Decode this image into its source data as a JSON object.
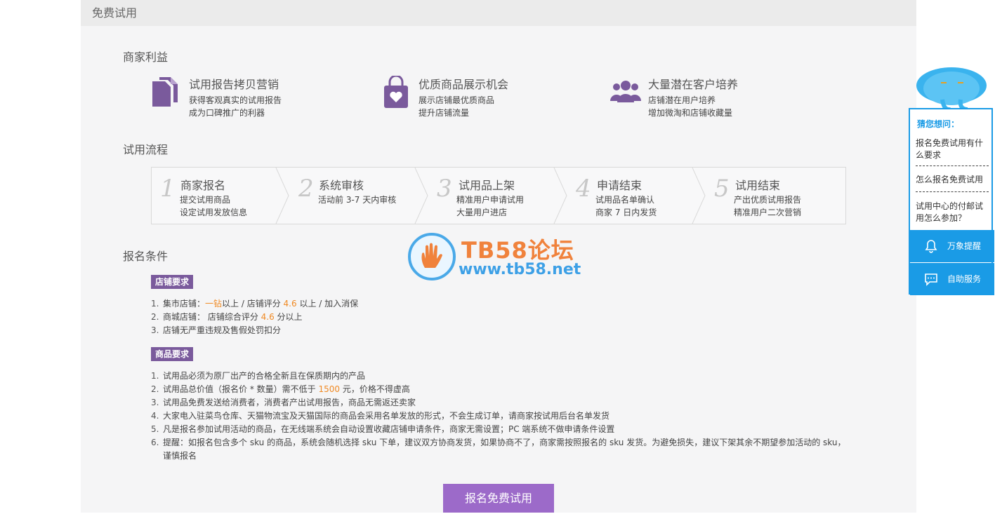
{
  "header": {
    "title": "免费试用"
  },
  "benefits_section": {
    "title": "商家利益",
    "items": [
      {
        "icon": "document-copy-icon",
        "title": "试用报告拷贝营销",
        "lines": [
          "获得客观真实的试用报告",
          "成为口碑推广的利器"
        ]
      },
      {
        "icon": "shopping-bag-heart-icon",
        "title": "优质商品展示机会",
        "lines": [
          "展示店铺最优质商品",
          "提升店铺流量"
        ]
      },
      {
        "icon": "users-group-icon",
        "title": "大量潜在客户培养",
        "lines": [
          "店铺潜在用户培养",
          "增加微淘和店铺收藏量"
        ]
      }
    ]
  },
  "process_section": {
    "title": "试用流程",
    "steps": [
      {
        "num": "1",
        "title": "商家报名",
        "lines": [
          "提交试用商品",
          "设定试用发放信息"
        ]
      },
      {
        "num": "2",
        "title": "系统审核",
        "lines": [
          "活动前 3-7 天内审核"
        ]
      },
      {
        "num": "3",
        "title": "试用品上架",
        "lines": [
          "精准用户申请试用",
          "大量用户进店"
        ]
      },
      {
        "num": "4",
        "title": "申请结束",
        "lines": [
          "试用品名单确认",
          "商家 7 日内发货"
        ]
      },
      {
        "num": "5",
        "title": "试用结束",
        "lines": [
          "产出优质试用报告",
          "精准用户二次营销"
        ]
      }
    ]
  },
  "conditions_section": {
    "title": "报名条件",
    "shop_tag": "店铺要求",
    "shop_items": [
      {
        "n": "1.",
        "p1": "集市店铺：",
        "h1": "一钻",
        "p2": "以上 / 店铺评分 ",
        "h2": "4.6",
        "p3": " 以上 / 加入消保"
      },
      {
        "n": "2.",
        "p1": "商城店铺： 店铺综合评分 ",
        "h1": "4.6",
        "p2": " 分以上",
        "h2": "",
        "p3": ""
      },
      {
        "n": "3.",
        "p1": "店铺无严重违规及售假处罚扣分",
        "h1": "",
        "p2": "",
        "h2": "",
        "p3": ""
      }
    ],
    "product_tag": "商品要求",
    "product_items": [
      {
        "n": "1.",
        "p1": "试用品必须为原厂出产的合格全新且在保质期内的产品",
        "h1": "",
        "p2": ""
      },
      {
        "n": "2.",
        "p1": "试用品总价值（报名价 * 数量）需不低于 ",
        "h1": "1500",
        "p2": " 元，价格不得虚高"
      },
      {
        "n": "3.",
        "p1": "试用品免费发送给消费者，消费者产出试用报告，商品无需返还卖家",
        "h1": "",
        "p2": ""
      },
      {
        "n": "4.",
        "p1": "大家电入驻菜鸟仓库、天猫物流宝及天猫国际的商品会采用名单发放的形式，不会生成订单，请商家按试用后台名单发货",
        "h1": "",
        "p2": ""
      },
      {
        "n": "5.",
        "p1": "凡是报名参加试用活动的商品，在无线端系统会自动设置收藏店铺申请条件，商家无需设置；PC 端系统不做申请条件设置",
        "h1": "",
        "p2": ""
      },
      {
        "n": "6.",
        "p1": "提醒：如报名包含多个 sku 的商品，系统会随机选择 sku 下单，建议双方协商发货，如果协商不了，商家需按照报名的 sku 发货。为避免损失，建议下架其余不期望参加活动的 sku，",
        "h1": "",
        "p2": ""
      },
      {
        "n": "",
        "p1": "谨慎报名",
        "h1": "",
        "p2": ""
      }
    ]
  },
  "signup_button": {
    "label": "报名免费试用"
  },
  "watermark": {
    "title": "TB58论坛",
    "url": "www.tb58.net"
  },
  "side_widget": {
    "heading": "猜您想问：",
    "questions": [
      "报名免费试用有什么要求",
      "怎么报名免费试用",
      "试用中心的付邮试用怎么参加？"
    ],
    "buttons": [
      {
        "icon": "bell-icon",
        "label": "万象提醒"
      },
      {
        "icon": "chat-icon",
        "label": "自助服务"
      }
    ]
  },
  "colors": {
    "accent_purple": "#7a5a9c",
    "button_purple": "#9c6ac9",
    "highlight_orange": "#f08a24",
    "side_blue": "#1a9be6"
  }
}
